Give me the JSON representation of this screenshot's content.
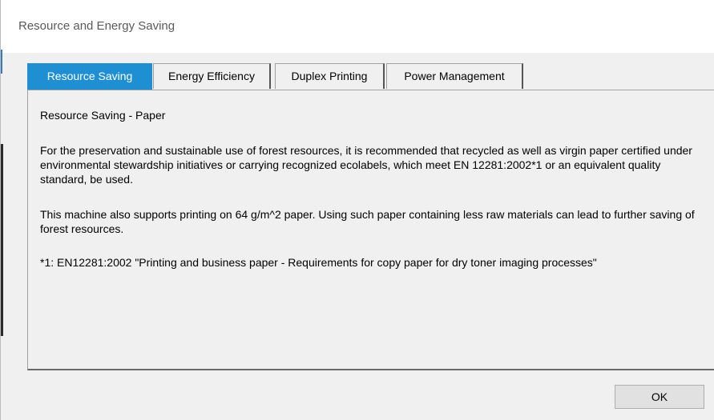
{
  "window": {
    "title": "Resource and Energy Saving"
  },
  "tabs": [
    {
      "label": "Resource Saving",
      "active": true
    },
    {
      "label": "Energy Efficiency",
      "active": false
    },
    {
      "label": "Duplex Printing",
      "active": false
    },
    {
      "label": "Power Management",
      "active": false
    }
  ],
  "content": {
    "heading": "Resource Saving - Paper",
    "paragraphs": [
      "For the preservation and sustainable use of forest resources, it is recommended that recycled as well as virgin paper certified under environmental stewardship initiatives or carrying  recognized ecolabels, which meet EN 12281:2002*1 or an equivalent quality standard, be used.",
      "This machine also supports printing on 64 g/m^2 paper.  Using such paper containing less raw materials can lead to further saving of forest resources.",
      "*1: EN12281:2002 \"Printing and business paper - Requirements for copy paper for dry toner imaging processes\""
    ]
  },
  "buttons": {
    "ok_label": "OK"
  },
  "colors": {
    "active_tab": "#1f8fd4",
    "window_bg": "#f0f0f0",
    "titlebar_bg": "#ffffff"
  }
}
